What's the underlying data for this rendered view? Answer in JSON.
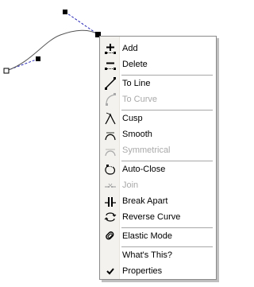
{
  "menu": {
    "items": [
      {
        "label": "Add",
        "enabled": true,
        "icon": "add-node-icon"
      },
      {
        "label": "Delete",
        "enabled": true,
        "icon": "delete-node-icon"
      },
      {
        "label": "To Line",
        "enabled": true,
        "icon": "to-line-icon"
      },
      {
        "label": "To Curve",
        "enabled": false,
        "icon": "to-curve-icon"
      },
      {
        "label": "Cusp",
        "enabled": true,
        "icon": "cusp-icon"
      },
      {
        "label": "Smooth",
        "enabled": true,
        "icon": "smooth-icon"
      },
      {
        "label": "Symmetrical",
        "enabled": false,
        "icon": "symmetrical-icon"
      },
      {
        "label": "Auto-Close",
        "enabled": true,
        "icon": "auto-close-icon"
      },
      {
        "label": "Join",
        "enabled": false,
        "icon": "join-icon"
      },
      {
        "label": "Break Apart",
        "enabled": true,
        "icon": "break-apart-icon"
      },
      {
        "label": "Reverse Curve",
        "enabled": true,
        "icon": "reverse-curve-icon"
      },
      {
        "label": "Elastic Mode",
        "enabled": true,
        "icon": "elastic-mode-icon"
      },
      {
        "label": "What's This?",
        "enabled": true,
        "icon": ""
      },
      {
        "label": "Properties",
        "enabled": true,
        "checked": true,
        "icon": "checkmark-icon"
      }
    ]
  },
  "colors": {
    "handle_line": "#2b2bb8",
    "curve": "#555555",
    "disabled_text": "#a9a9a9"
  }
}
